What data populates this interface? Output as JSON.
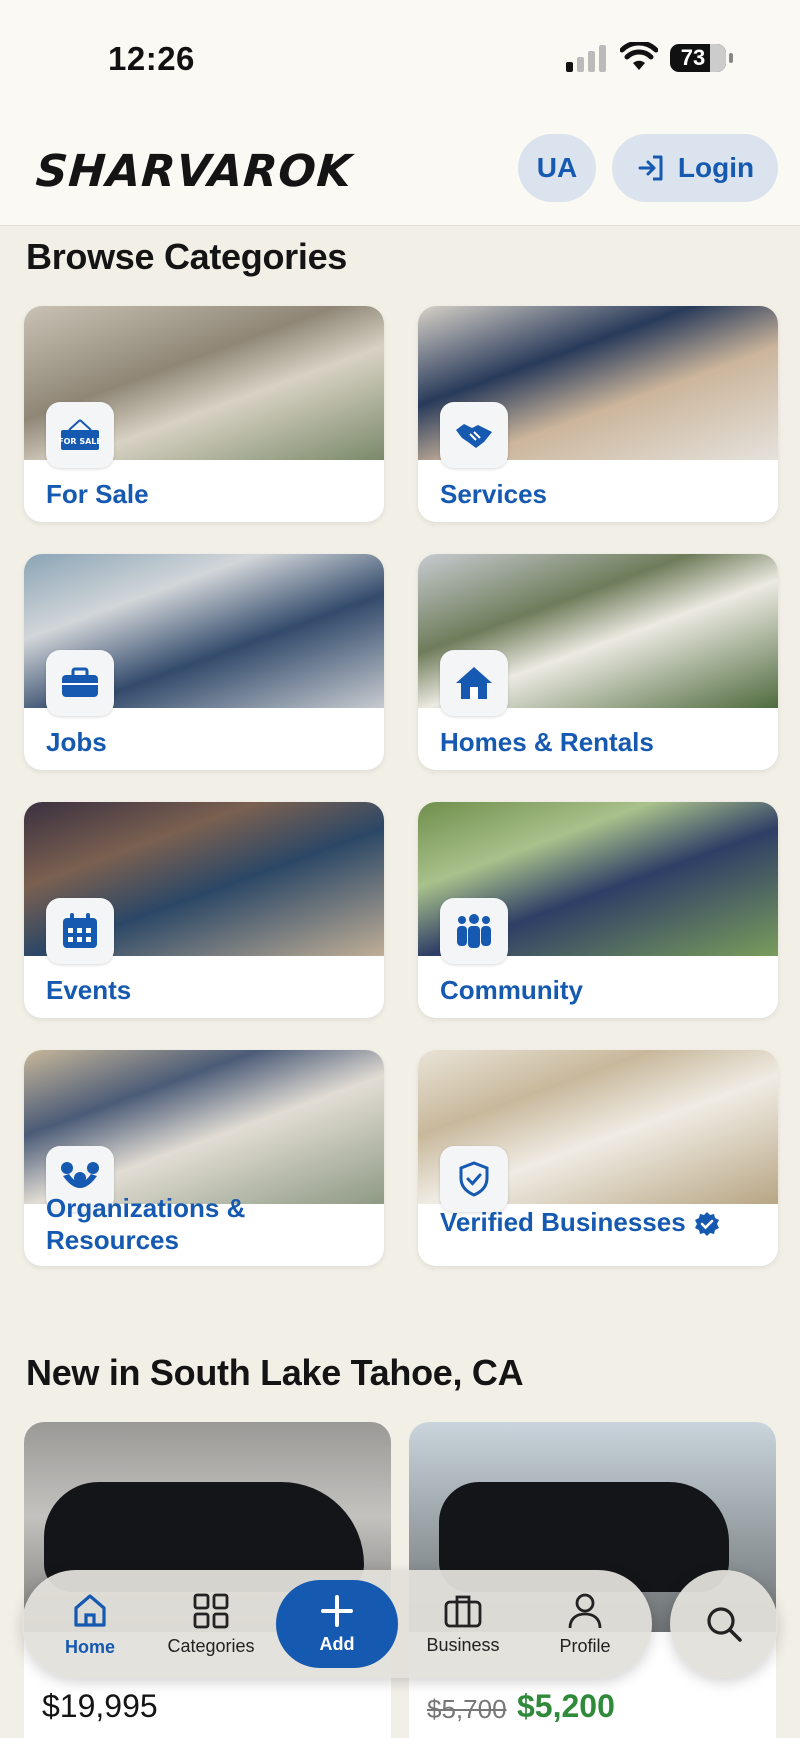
{
  "status_bar": {
    "time": "12:26",
    "battery": "73"
  },
  "header": {
    "logo": "SHARVAROK",
    "lang_button": "UA",
    "login_button": "Login"
  },
  "browse": {
    "title": "Browse Categories",
    "categories": [
      {
        "label": "For Sale",
        "icon": "for-sale-sign-icon",
        "icon_text": "FOR SALE"
      },
      {
        "label": "Services",
        "icon": "handshake-icon"
      },
      {
        "label": "Jobs",
        "icon": "briefcase-icon"
      },
      {
        "label": "Homes & Rentals",
        "icon": "house-icon"
      },
      {
        "label": "Events",
        "icon": "calendar-icon"
      },
      {
        "label": "Community",
        "icon": "people-group-icon"
      },
      {
        "label": "Organizations & Resources",
        "icon": "organization-icon"
      },
      {
        "label": "Verified Businesses",
        "icon": "shield-check-icon",
        "badge": "verified-badge-icon"
      }
    ]
  },
  "new_section": {
    "title": "New in South Lake Tahoe, CA",
    "listings": [
      {
        "price": "$19,995"
      },
      {
        "old_price": "$5,700",
        "new_price": "$5,200"
      }
    ]
  },
  "bottom_nav": {
    "items": [
      {
        "label": "Home",
        "icon": "home-icon",
        "active": true
      },
      {
        "label": "Categories",
        "icon": "grid-icon"
      },
      {
        "label": "Add",
        "icon": "plus-icon"
      },
      {
        "label": "Business",
        "icon": "briefcase-icon"
      },
      {
        "label": "Profile",
        "icon": "person-icon"
      }
    ],
    "search_icon": "search-icon"
  },
  "colors": {
    "accent": "#1559b0",
    "background": "#f2efe7",
    "price_green": "#2f8a3a"
  }
}
